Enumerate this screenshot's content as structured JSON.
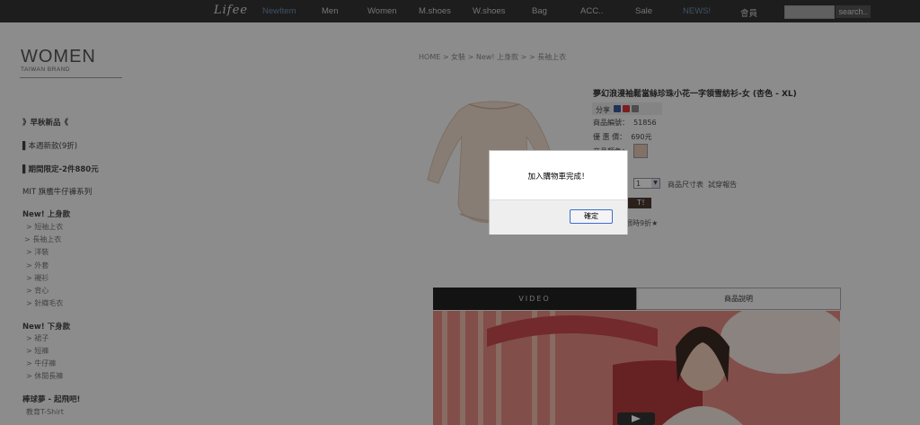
{
  "nav": {
    "logo": "Lifee",
    "items": [
      "NewItem",
      "Men",
      "Women",
      "M.shoes",
      "W.shoes",
      "Bag",
      "ACC..",
      "Sale",
      "NEWS!",
      "會員"
    ],
    "search_button": "search.."
  },
  "sidebar": {
    "brand": "WOMEN",
    "brand_sub": "TAIWAN BRAND",
    "items": [
      "》早秋新品《",
      "▌本週新款(9折)",
      "▌期間限定-2件880元",
      "MIT 旗艦牛仔褲系列",
      "New! 上身款",
      "> 短袖上衣",
      "> 長袖上衣",
      "> 洋裝",
      "> 外套",
      "> 襯衫",
      "> 背心",
      "> 針織毛衣",
      "New! 下身款",
      "> 裙子",
      "> 短褲",
      "> 牛仔褲",
      "> 休閒長褲",
      "棒球夢 - 起飛吧!",
      "教育T-Shirt"
    ]
  },
  "breadcrumb": "HOME > 女裝 > New! 上身款 > > 長袖上衣",
  "product": {
    "title": "夢幻浪漫袖鬆當絲珍珠小花一字領雪紡衫-女 (杏色 - XL)",
    "share_label": "分享",
    "code_label": "商品編號：",
    "code": "51856",
    "price_label": "優 惠 價：",
    "price": "690元",
    "color_label": "商品顏色：",
    "qty": "1",
    "size_link": "商品尺寸表",
    "review_link": "試穿報告",
    "buy_label": "T！",
    "promo": "限時9折★"
  },
  "tabs": [
    "VIDEO",
    "商品說明"
  ],
  "dialog": {
    "message": "加入購物車完成！",
    "ok": "確定"
  },
  "colors": {
    "nav_bg": "#333333",
    "overlay": "rgba(0,0,0,0.43)",
    "nav_active": "#6f8fb0",
    "buy_button": "#4a3a33"
  }
}
